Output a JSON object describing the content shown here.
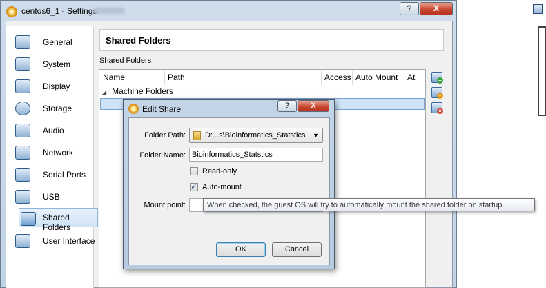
{
  "window": {
    "title": "centos6_1 - Settings",
    "help_label": "?",
    "close_label": "X"
  },
  "sidebar": {
    "items": [
      {
        "label": "General",
        "icon": "monitor-icon"
      },
      {
        "label": "System",
        "icon": "chip-icon"
      },
      {
        "label": "Display",
        "icon": "display-icon"
      },
      {
        "label": "Storage",
        "icon": "disk-icon"
      },
      {
        "label": "Audio",
        "icon": "speaker-icon"
      },
      {
        "label": "Network",
        "icon": "network-icon"
      },
      {
        "label": "Serial Ports",
        "icon": "serial-port-icon"
      },
      {
        "label": "USB",
        "icon": "usb-icon"
      },
      {
        "label": "Shared Folders",
        "icon": "folder-icon",
        "active": true
      },
      {
        "label": "User Interface",
        "icon": "window-icon"
      }
    ]
  },
  "content": {
    "header": "Shared Folders",
    "group_label": "Shared Folders",
    "columns": [
      "Name",
      "Path",
      "Access",
      "Auto Mount",
      "At"
    ],
    "tree": {
      "root": "Machine Folders"
    }
  },
  "dialog": {
    "title": "Edit Share",
    "help_label": "?",
    "close_label": "X",
    "folder_path_label": "Folder Path:",
    "folder_path_value": "D:...s\\Bioinformatics_Statstics",
    "folder_name_label": "Folder Name:",
    "folder_name_value": "Bioinformatics_Statstics",
    "readonly_label": "Read-only",
    "readonly_checked": false,
    "automount_label": "Auto-mount",
    "automount_checked": true,
    "mount_point_label": "Mount point:",
    "mount_point_value": "",
    "ok_label": "OK",
    "cancel_label": "Cancel"
  },
  "tooltip": "When checked, the guest OS will try to automatically mount the shared folder on startup."
}
